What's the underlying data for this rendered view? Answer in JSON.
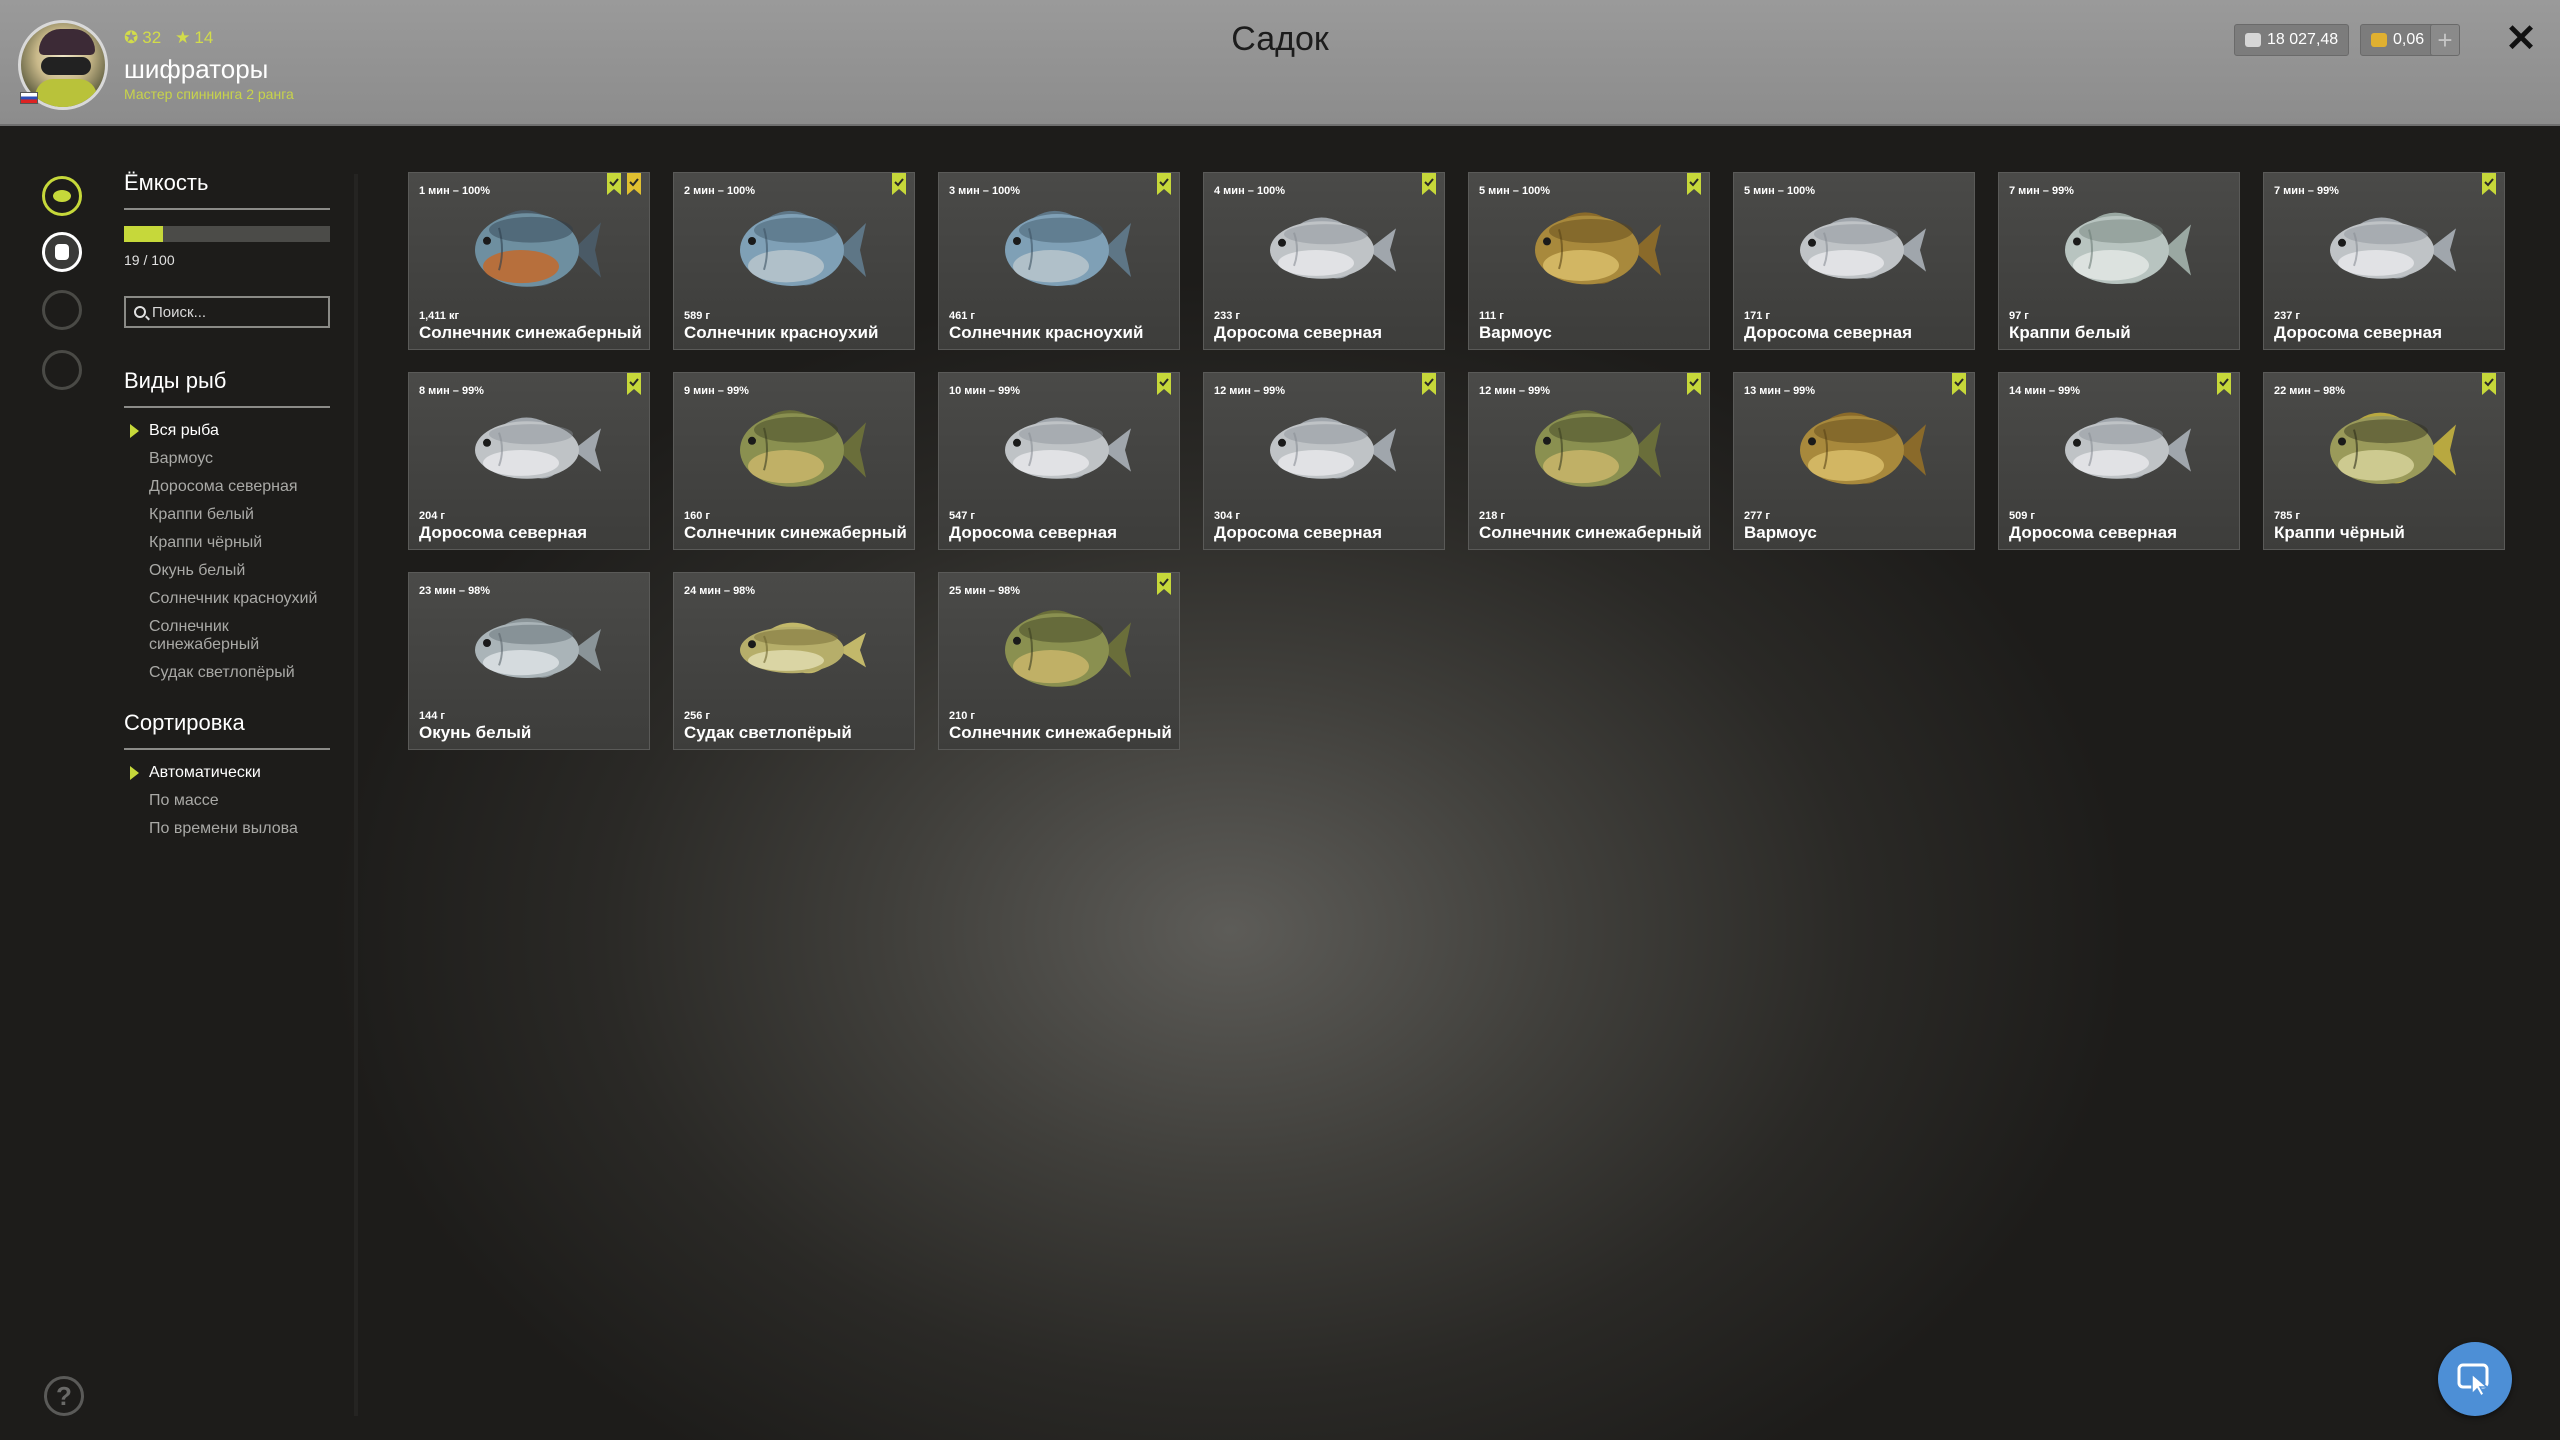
{
  "header": {
    "title": "Садок",
    "player": {
      "nickname": "шифраторы",
      "rank_title": "Мастер спиннинга 2 ранга",
      "level": "32",
      "stars": "14"
    },
    "currency": {
      "silver": "18 027,48",
      "gold": "0,06"
    },
    "plus_label": "+",
    "close_label": "✕"
  },
  "sidebar": {
    "capacity": {
      "title": "Ёмкость",
      "text": "19 / 100",
      "fill_fraction": 0.19
    },
    "search": {
      "placeholder": "Поиск..."
    },
    "species": {
      "title": "Виды рыб",
      "items": [
        {
          "label": "Вся рыба",
          "active": true
        },
        {
          "label": "Вармоус",
          "active": false
        },
        {
          "label": "Доросома северная",
          "active": false
        },
        {
          "label": "Краппи белый",
          "active": false
        },
        {
          "label": "Краппи чёрный",
          "active": false
        },
        {
          "label": "Окунь белый",
          "active": false
        },
        {
          "label": "Солнечник красноухий",
          "active": false
        },
        {
          "label": "Солнечник синежаберный",
          "active": false
        },
        {
          "label": "Судак светлопёрый",
          "active": false
        }
      ]
    },
    "sort": {
      "title": "Сортировка",
      "items": [
        {
          "label": "Автоматически",
          "active": true
        },
        {
          "label": "По массе",
          "active": false
        },
        {
          "label": "По времени вылова",
          "active": false
        }
      ]
    },
    "help_label": "?"
  },
  "colors": {
    "accent": "#c6d83a",
    "bookmark_green": "#c6d83a",
    "bookmark_yellow": "#e0c030",
    "chat": "#4d8fd6"
  },
  "fish": [
    {
      "meta": "1 мин – 100%",
      "weight": "1,411 кг",
      "name": "Солнечник синежаберный",
      "kind": "bluegill",
      "bookmarks": [
        "green",
        "yellow"
      ]
    },
    {
      "meta": "2 мин – 100%",
      "weight": "589 г",
      "name": "Солнечник красноухий",
      "kind": "redear",
      "bookmarks": [
        "green"
      ]
    },
    {
      "meta": "3 мин – 100%",
      "weight": "461 г",
      "name": "Солнечник красноухий",
      "kind": "redear",
      "bookmarks": [
        "green"
      ]
    },
    {
      "meta": "4 мин – 100%",
      "weight": "233 г",
      "name": "Доросома северная",
      "kind": "shad",
      "bookmarks": [
        "green"
      ]
    },
    {
      "meta": "5 мин – 100%",
      "weight": "111 г",
      "name": "Вармоус",
      "kind": "warmouth",
      "bookmarks": [
        "green"
      ]
    },
    {
      "meta": "5 мин – 100%",
      "weight": "171 г",
      "name": "Доросома северная",
      "kind": "shad",
      "bookmarks": []
    },
    {
      "meta": "7 мин – 99%",
      "weight": "97 г",
      "name": "Краппи белый",
      "kind": "crappie_white",
      "bookmarks": []
    },
    {
      "meta": "7 мин – 99%",
      "weight": "237 г",
      "name": "Доросома северная",
      "kind": "shad",
      "bookmarks": [
        "green"
      ]
    },
    {
      "meta": "8 мин – 99%",
      "weight": "204 г",
      "name": "Доросома северная",
      "kind": "shad",
      "bookmarks": [
        "green"
      ]
    },
    {
      "meta": "9 мин – 99%",
      "weight": "160 г",
      "name": "Солнечник синежаберный",
      "kind": "bluegill_green",
      "bookmarks": []
    },
    {
      "meta": "10 мин – 99%",
      "weight": "547 г",
      "name": "Доросома северная",
      "kind": "shad",
      "bookmarks": [
        "green"
      ]
    },
    {
      "meta": "12 мин – 99%",
      "weight": "304 г",
      "name": "Доросома северная",
      "kind": "shad",
      "bookmarks": [
        "green"
      ]
    },
    {
      "meta": "12 мин – 99%",
      "weight": "218 г",
      "name": "Солнечник синежаберный",
      "kind": "bluegill_green",
      "bookmarks": [
        "green"
      ]
    },
    {
      "meta": "13 мин – 99%",
      "weight": "277 г",
      "name": "Вармоус",
      "kind": "warmouth",
      "bookmarks": [
        "green"
      ]
    },
    {
      "meta": "14 мин – 99%",
      "weight": "509 г",
      "name": "Доросома северная",
      "kind": "shad",
      "bookmarks": [
        "green"
      ]
    },
    {
      "meta": "22 мин – 98%",
      "weight": "785 г",
      "name": "Краппи чёрный",
      "kind": "crappie_black",
      "bookmarks": [
        "green"
      ]
    },
    {
      "meta": "23 мин – 98%",
      "weight": "144 г",
      "name": "Окунь белый",
      "kind": "white_perch",
      "bookmarks": []
    },
    {
      "meta": "24 мин – 98%",
      "weight": "256 г",
      "name": "Судак светлопёрый",
      "kind": "walleye",
      "bookmarks": []
    },
    {
      "meta": "25 мин – 98%",
      "weight": "210 г",
      "name": "Солнечник синежаберный",
      "kind": "bluegill_green",
      "bookmarks": [
        "green"
      ]
    }
  ]
}
